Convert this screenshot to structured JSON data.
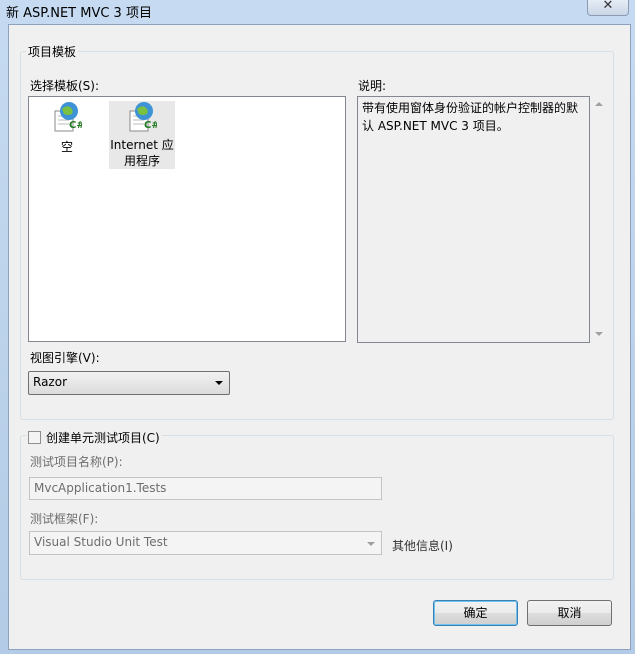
{
  "window": {
    "title": "新 ASP.NET MVC 3 项目",
    "close_label": "✕"
  },
  "project_template": {
    "group_label": "项目模板",
    "select_label": "选择模板(S):",
    "templates": [
      {
        "label": "空",
        "icon": "web-csharp-project-icon",
        "selected": false
      },
      {
        "label": "Internet 应用程序",
        "label_line1": "Internet 应",
        "label_line2": "用程序",
        "icon": "web-csharp-project-icon",
        "selected": true
      }
    ],
    "description_label": "说明:",
    "description_text": "带有使用窗体身份验证的帐户控制器的默认 ASP.NET MVC 3 项目。",
    "description_line1": "带有使用窗体身份验证的帐户控制器的默",
    "description_line2": "认 ASP.NET MVC 3 项目。",
    "view_engine_label": "视图引擎(V):",
    "view_engine_value": "Razor"
  },
  "unit_test": {
    "checkbox_label": "创建单元测试项目(C)",
    "checked": false,
    "project_name_label": "测试项目名称(P):",
    "project_name_value": "MvcApplication1.Tests",
    "framework_label": "测试框架(F):",
    "framework_value": "Visual Studio Unit Test",
    "more_info_label": "其他信息(I)"
  },
  "buttons": {
    "ok": "确定",
    "cancel": "取消"
  },
  "colors": {
    "title_bar": "#c6dbf1",
    "dialog_bg": "#f0f0f0",
    "default_button_border": "#3c7fb1"
  }
}
